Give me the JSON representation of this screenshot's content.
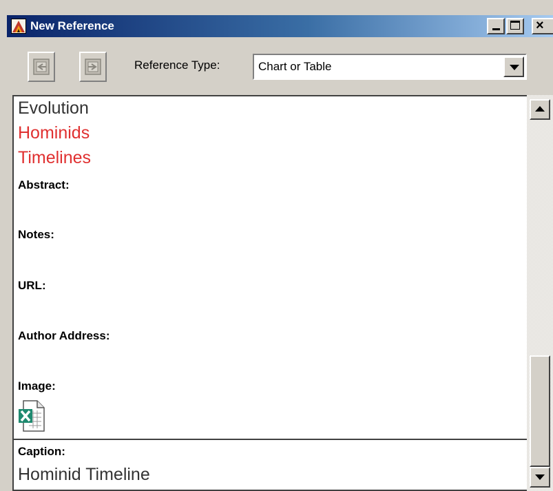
{
  "window": {
    "title": "New Reference",
    "app_icon": "endnote-logo-icon",
    "controls": [
      "minimize-icon",
      "maximize-icon",
      "close-icon"
    ],
    "title_gradient": [
      "#0a246a",
      "#a6caf0"
    ]
  },
  "toolbar": {
    "button1_icon": "previous-reference-icon",
    "button2_icon": "next-reference-icon",
    "reference_type_label": "Reference Type:",
    "reference_type_value": "Chart or Table"
  },
  "fields": {
    "keywords": [
      {
        "text": "Evolution",
        "color": "#333333"
      },
      {
        "text": "Hominids",
        "color": "#e03030"
      },
      {
        "text": "Timelines",
        "color": "#e03030"
      }
    ],
    "abstract_label": "Abstract:",
    "notes_label": "Notes:",
    "url_label": "URL:",
    "author_address_label": "Author Address:",
    "image_label": "Image:",
    "image_icon": "excel-file-icon",
    "caption_label": "Caption:",
    "caption_value": "Hominid Timeline"
  }
}
